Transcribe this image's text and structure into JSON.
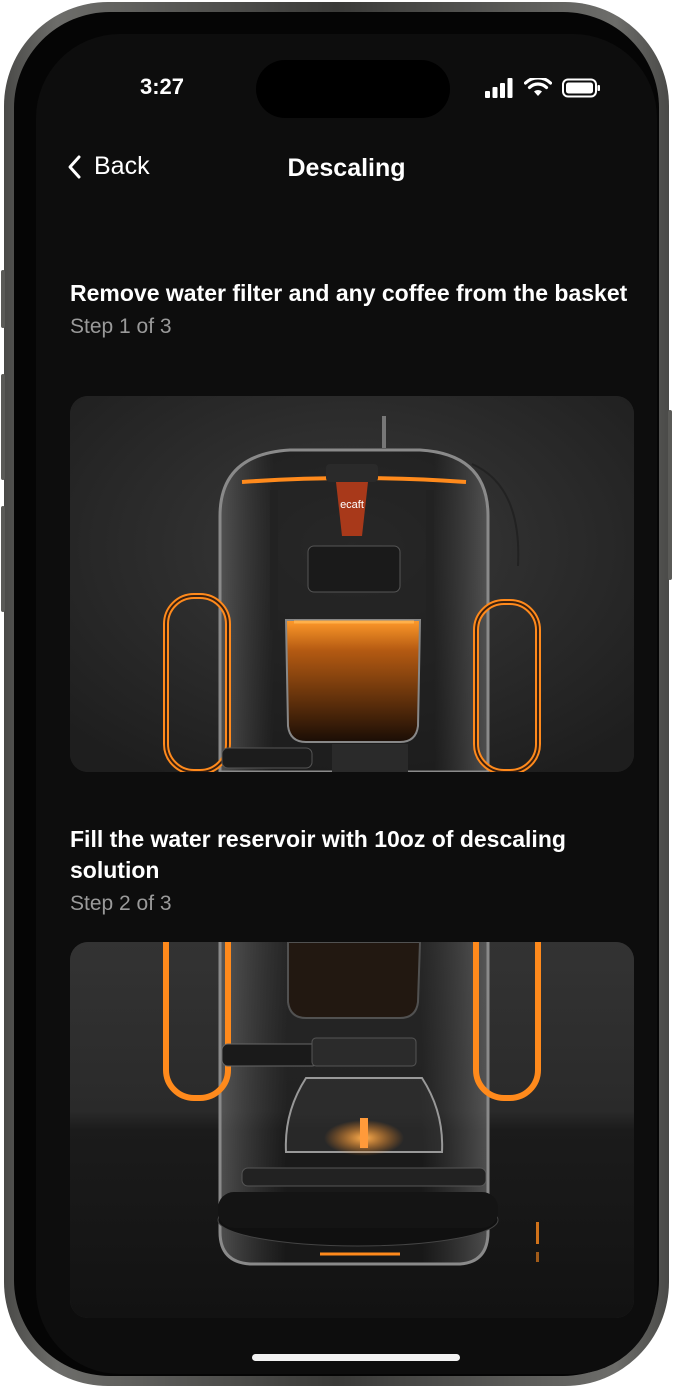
{
  "status_bar": {
    "time": "3:27",
    "icons": [
      "cellular-signal-icon",
      "wifi-icon",
      "battery-icon"
    ]
  },
  "nav": {
    "back_label": "Back",
    "title": "Descaling"
  },
  "steps": [
    {
      "title": "Remove water filter and any coffee from the basket",
      "subtitle": "Step 1 of 3",
      "image": "coffee-machine-photo"
    },
    {
      "title": "Fill the water reservoir with 10oz of descaling solution",
      "subtitle": "Step 2 of 3",
      "image": "coffee-machine-base-photo"
    }
  ],
  "colors": {
    "background": "#0d0d0d",
    "text_primary": "#ffffff",
    "text_secondary": "#9a9a9a",
    "accent_glow": "#ff8a1c"
  }
}
